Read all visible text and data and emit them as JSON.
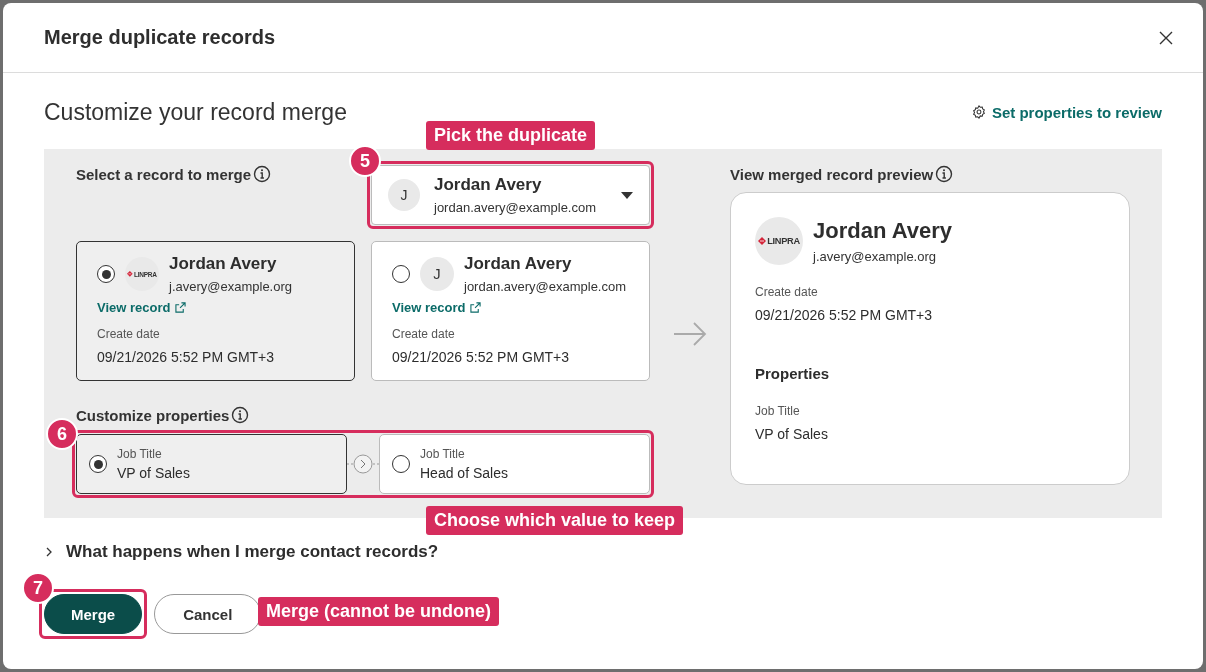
{
  "dialog": {
    "title": "Merge duplicate records"
  },
  "heading": "Customize your record merge",
  "settings_link": "Set properties to review",
  "select_record": {
    "label": "Select a record to merge",
    "dropdown": {
      "avatar": {
        "kind": "initial",
        "text": "J"
      },
      "name": "Jordan Avery",
      "email": "jordan.avery@example.com"
    },
    "callout": {
      "number": "5",
      "label": "Pick the duplicate"
    }
  },
  "records": [
    {
      "selected": true,
      "avatar": {
        "kind": "logo",
        "text": "LINPRA"
      },
      "name": "Jordan Avery",
      "email": "j.avery@example.org",
      "link": "View record",
      "date_label": "Create date",
      "date": "09/21/2026 5:52 PM GMT+3"
    },
    {
      "selected": false,
      "avatar": {
        "kind": "initial",
        "text": "J"
      },
      "name": "Jordan Avery",
      "email": "jordan.avery@example.com",
      "link": "View record",
      "date_label": "Create date",
      "date": "09/21/2026 5:52 PM GMT+3"
    }
  ],
  "customize": {
    "label": "Customize properties",
    "options": [
      {
        "selected": true,
        "label": "Job Title",
        "value": "VP of Sales"
      },
      {
        "selected": false,
        "label": "Job Title",
        "value": "Head of Sales"
      }
    ],
    "callout": {
      "number": "6",
      "label": "Choose which value to keep"
    }
  },
  "preview": {
    "label": "View merged record preview",
    "avatar": {
      "kind": "logo",
      "text": "LINPRA"
    },
    "name": "Jordan Avery",
    "email": "j.avery@example.org",
    "date_label": "Create date",
    "date": "09/21/2026 5:52 PM GMT+3",
    "section": "Properties",
    "property_label": "Job Title",
    "property_value": "VP of Sales"
  },
  "disclosure": {
    "label": "What happens when I merge contact records?",
    "expanded": false
  },
  "buttons": [
    {
      "kind": "primary",
      "label": "Merge",
      "callout": {
        "number": "7",
        "label": "Merge (cannot be undone)"
      }
    },
    {
      "kind": "secondary",
      "label": "Cancel"
    }
  ]
}
